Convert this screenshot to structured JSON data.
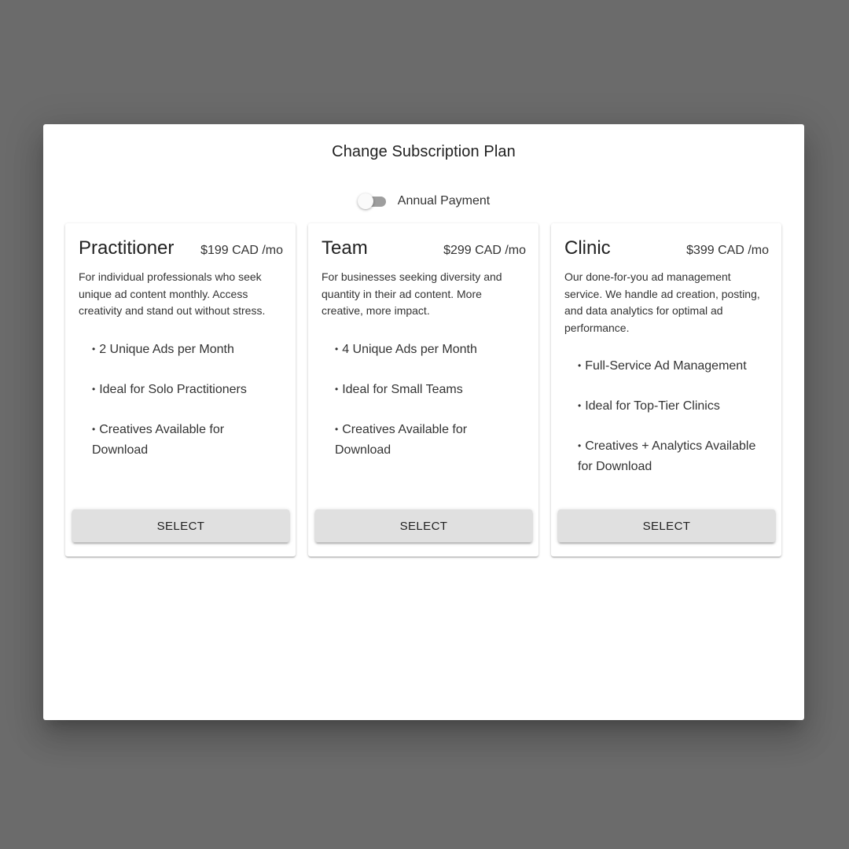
{
  "dialog": {
    "title": "Change Subscription Plan",
    "toggle": {
      "label": "Annual Payment",
      "checked": false
    }
  },
  "plans": [
    {
      "name": "Practitioner",
      "price": "$199 CAD /mo",
      "description": "For individual professionals who seek unique ad content monthly. Access creativity and stand out without stress.",
      "features": [
        "2 Unique Ads per Month",
        "Ideal for Solo Practitioners",
        "Creatives Available for Download"
      ],
      "button": "SELECT"
    },
    {
      "name": "Team",
      "price": "$299 CAD /mo",
      "description": "For businesses seeking diversity and quantity in their ad content. More creative, more impact.",
      "features": [
        "4 Unique Ads per Month",
        "Ideal for Small Teams",
        "Creatives Available for Download"
      ],
      "button": "SELECT"
    },
    {
      "name": "Clinic",
      "price": "$399 CAD /mo",
      "description": "Our done-for-you ad management service. We handle ad creation, posting, and data analytics for optimal ad performance.",
      "features": [
        "Full-Service Ad Management",
        "Ideal for Top-Tier Clinics",
        "Creatives + Analytics Available for Download"
      ],
      "button": "SELECT"
    }
  ],
  "colors": {
    "backdrop": "#6b6b6b",
    "dialog": "#ffffff",
    "button": "#e0e0e0",
    "switch_track": "#9e9e9e",
    "switch_thumb": "#fafafa"
  }
}
